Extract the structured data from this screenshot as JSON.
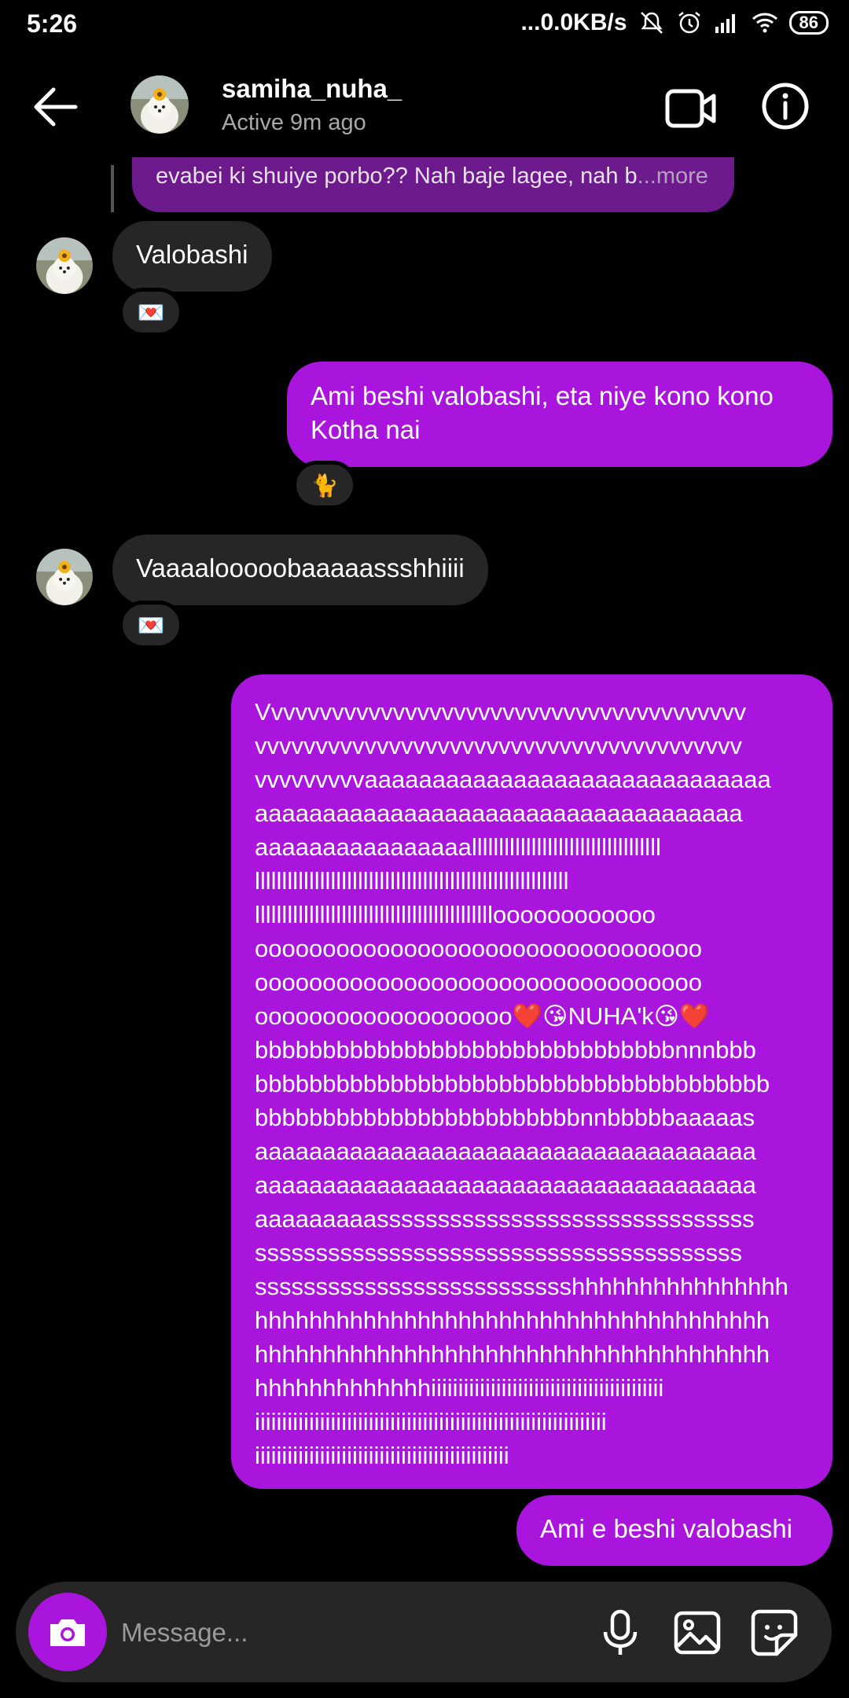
{
  "status_bar": {
    "time": "5:26",
    "network_speed": "...0.0KB/s",
    "battery": "86",
    "icons": [
      "mute-icon",
      "alarm-icon",
      "signal-icon",
      "wifi-icon",
      "battery-icon"
    ]
  },
  "header": {
    "username": "samiha_nuha_",
    "status": "Active 9m ago",
    "icons": [
      "back-arrow-icon",
      "video-camera-icon",
      "info-icon"
    ]
  },
  "messages": {
    "quoted_text": "evabei ki shuiye porbo?? Nah baje lagee, nah b",
    "quoted_more": "...more",
    "m1_text": "Valobashi",
    "m1_reaction": "💌",
    "m2_line1": "Ami beshi valobashi, eta niye kono kono",
    "m2_line2": "Kotha nai",
    "m2_reaction": "🐈",
    "m3_text": "Vaaaalooooobaaaaassshhiiii",
    "m3_reaction": "💌",
    "m4_lines": [
      "Vvvvvvvvvvvvvvvvvvvvvvvvvvvvvvvvvvvvvvvv",
      "vvvvvvvvvvvvvvvvvvvvvvvvvvvvvvvvvvvvvvvv",
      "vvvvvvvvvaaaaaaaaaaaaaaaaaaaaaaaaaaaaaa",
      "aaaaaaaaaaaaaaaaaaaaaaaaaaaaaaaaaaaa",
      "aaaaaaaaaaaaaaaalllllllllllllllllllllllllllllllllll",
      "llllllllllllllllllllllllllllllllllllllllllllllllllllllllll",
      "lllllllllllllllllllllllllllllllllllllllllllloooooooooooo",
      "ooooooooooooooooooooooooooooooooo",
      "ooooooooooooooooooooooooooooooooo",
      "ooooooooooooooooooo❤️😘NUHA'k😘❤️",
      "bbbbbbbbbbbbbbbbbbbbbbbbbbbbbbbnnnbbb",
      "bbbbbbbbbbbbbbbbbbbbbbbbbbbbbbbbbbbbbb",
      "bbbbbbbbbbbbbbbbbbbbbbbbnnbbbbbaaaaas",
      "aaaaaaaaaaaaaaaaaaaaaaaaaaaaaaaaaaaaa",
      "aaaaaaaaaaaaaaaaaaaaaaaaaaaaaaaaaaaaa",
      "aaaaaaaaasssssssssssssssssssssssssssssss",
      "ssssssssssssssssssssssssssssssssssssssss",
      "sssssssssssssssssssssssssshhhhhhhhhhhhhhhh",
      "hhhhhhhhhhhhhhhhhhhhhhhhhhhhhhhhhhhhhh",
      "hhhhhhhhhhhhhhhhhhhhhhhhhhhhhhhhhhhhhh",
      "hhhhhhhhhhhhhiiiiiiiiiiiiiiiiiiiiiiiiiiiiiiiiiiiiiiiiiii",
      "iiiiiiiiiiiiiiiiiiiiiiiiiiiiiiiiiiiiiiiiiiiiiiiiiiiiiiiiiiiiiiiii",
      "iiiiiiiiiiiiiiiiiiiiiiiiiiiiiiiiiiiiiiiiiiiiiii"
    ],
    "m5_text": "Ami e beshi valobashi"
  },
  "composer": {
    "placeholder": "Message...",
    "icons": [
      "camera-icon",
      "microphone-icon",
      "gallery-icon",
      "sticker-icon"
    ]
  },
  "colors": {
    "background": "#000000",
    "incoming_bubble": "#262626",
    "outgoing_bubble": "#a915dd",
    "quoted_bubble": "#6d1a8c",
    "secondary_text": "#a8a8a8"
  }
}
